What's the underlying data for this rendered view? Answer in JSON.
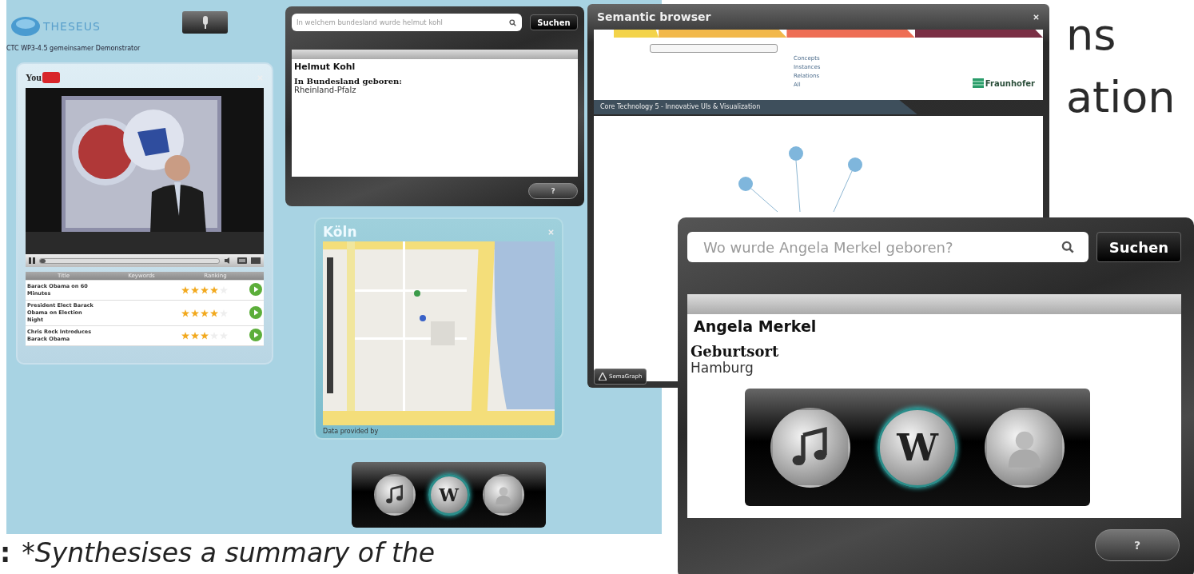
{
  "slide_text": {
    "heading_fragments": [
      "ns",
      "ation"
    ],
    "caption_mark": ":",
    "caption": "*Synthesises a summary of the"
  },
  "demonstrator": {
    "logo": "THESEUS",
    "subtitle": "CTC WP3-4.5 gemeinsamer Demonstrator"
  },
  "video_window": {
    "logo": "You",
    "progress": {
      "level": 0.03
    },
    "columns": [
      "Title",
      "Keywords",
      "Ranking"
    ],
    "rows": [
      {
        "title": "Barack Obama on 60 Minutes",
        "stars": 4
      },
      {
        "title": "President Elect Barack Obama on Election Night",
        "stars": 4
      },
      {
        "title": "Chris Rock Introduces Barack Obama",
        "stars": 3
      }
    ]
  },
  "kohl_search": {
    "query": "In welchem bundesland wurde helmut kohl",
    "button": "Suchen",
    "result_name": "Helmut Kohl",
    "field_label": "In Bundesland geboren:",
    "field_value": "Rheinland-Pfalz",
    "help": "?"
  },
  "semantic_browser": {
    "title": "Semantic browser",
    "tabs": [
      {
        "color": "#f3d34a"
      },
      {
        "color": "#f2b84a"
      },
      {
        "color": "#ee6e55"
      },
      {
        "color": "#7a2f45"
      }
    ],
    "links": [
      "Concepts",
      "Instances",
      "Relations",
      "All"
    ],
    "logo": "Fraunhofer",
    "breadcrumb": "Core Technology 5 - Innovative UIs & Visualization",
    "footer_button": "SemaGraph"
  },
  "map_window": {
    "title": "Köln",
    "attribution": "Data provided by"
  },
  "media_dock": {
    "items": [
      {
        "kind": "music",
        "selected": false
      },
      {
        "kind": "wiki",
        "label": "W",
        "selected": true
      },
      {
        "kind": "person",
        "selected": false
      }
    ]
  },
  "merkel_search": {
    "placeholder": "Wo wurde Angela Merkel geboren?",
    "button": "Suchen",
    "result_name": "Angela Merkel",
    "field_label": "Geburtsort",
    "field_value": "Hamburg",
    "dock": [
      {
        "kind": "music",
        "selected": false
      },
      {
        "kind": "wiki",
        "label": "W",
        "selected": true
      },
      {
        "kind": "person",
        "selected": false
      }
    ],
    "help": "?"
  }
}
